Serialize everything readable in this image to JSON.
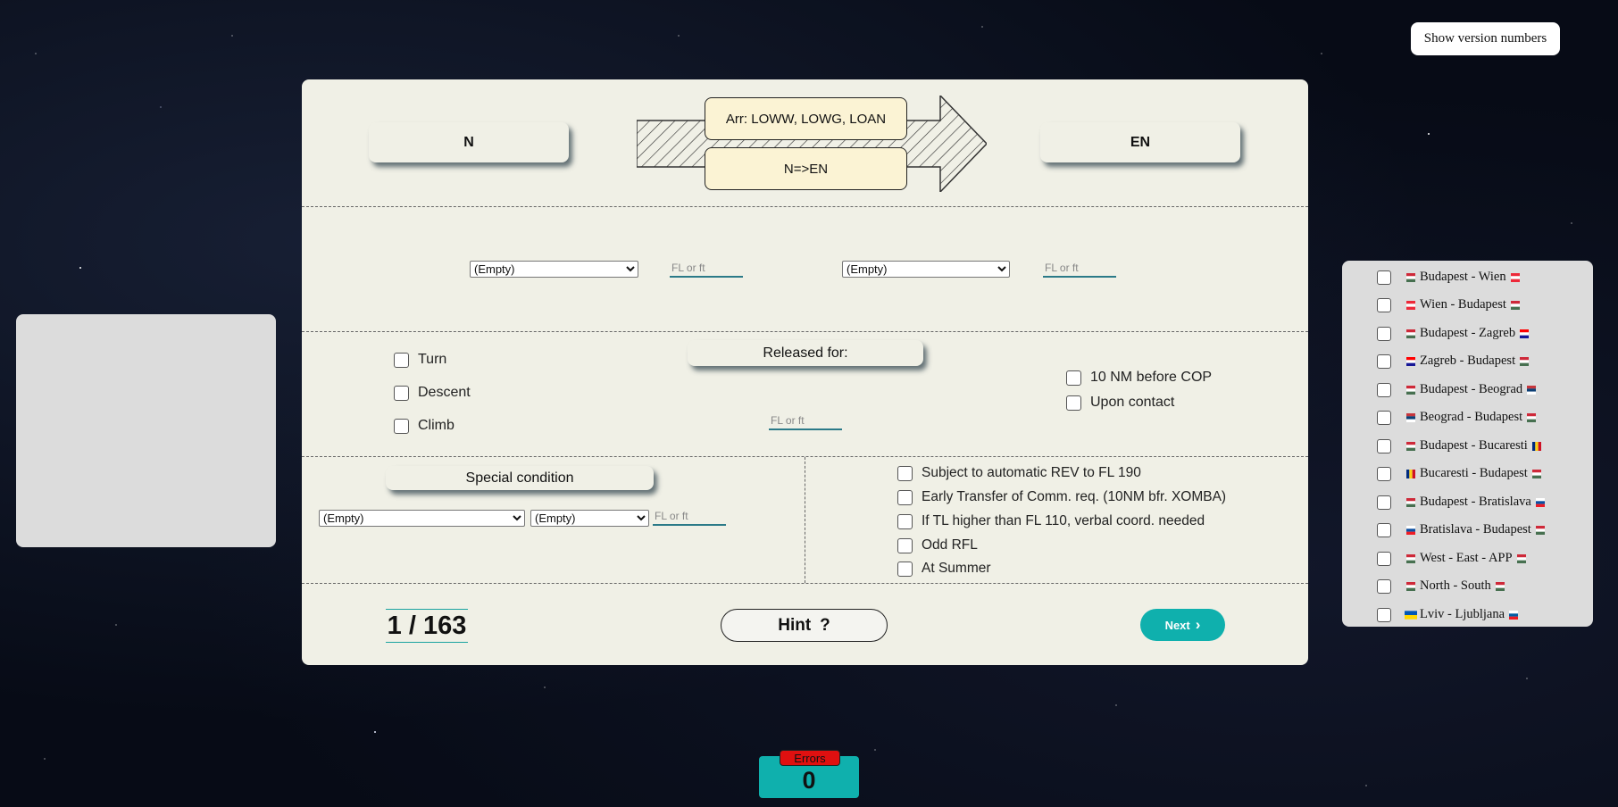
{
  "header": {
    "version_button": "Show version numbers"
  },
  "strip": {
    "from_sector": "N",
    "to_sector": "EN",
    "arrivals": "Arr: LOWW, LOWG, LOAN",
    "transfer": "N=>EN"
  },
  "levels": {
    "select1": "(Empty)",
    "select2": "(Empty)",
    "fl_placeholder": "FL or ft"
  },
  "release": {
    "title": "Released for:",
    "options": [
      "Turn",
      "Descent",
      "Climb"
    ],
    "fl_placeholder": "FL or ft",
    "timing_options": [
      "10 NM before COP",
      "Upon contact"
    ]
  },
  "special": {
    "title": "Special condition",
    "select1": "(Empty)",
    "select2": "(Empty)",
    "fl_placeholder": "FL or ft",
    "conditions": [
      "Subject to automatic REV to FL 190",
      "Early Transfer of Comm. req. (10NM bfr. XOMBA)",
      "If TL higher than FL 110, verbal coord. needed",
      "Odd RFL",
      "At Summer"
    ]
  },
  "footer": {
    "counter": "1 / 163",
    "hint_label": "Hint",
    "hint_symbol": "?",
    "next_label": "Next",
    "next_symbol": "›"
  },
  "routes": [
    "Budapest - Wien",
    "Wien - Budapest",
    "Budapest - Zagreb",
    "Zagreb - Budapest",
    "Budapest - Beograd",
    "Beograd - Budapest",
    "Budapest - Bucaresti",
    "Bucaresti - Budapest",
    "Budapest - Bratislava",
    "Bratislava - Budapest",
    "West - East - APP",
    "North - South",
    "Lviv - Ljubljana"
  ],
  "errors": {
    "label": "Errors",
    "count": "0"
  }
}
